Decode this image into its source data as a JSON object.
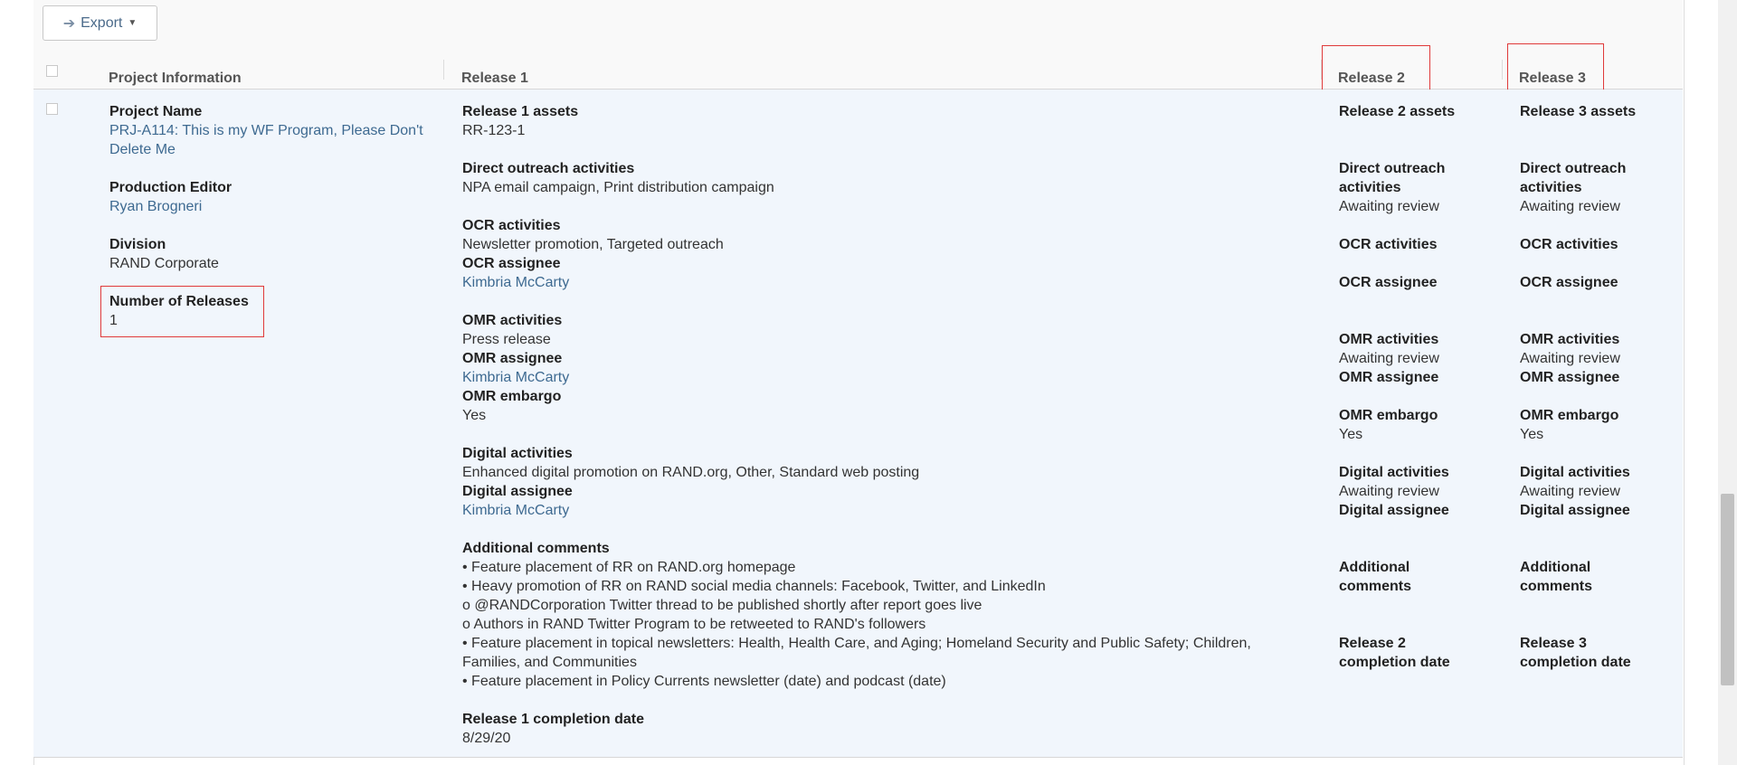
{
  "toolbar": {
    "export_label": "Export"
  },
  "headers": {
    "project_information": "Project Information",
    "release1": "Release 1",
    "release2": "Release 2",
    "release3": "Release 3"
  },
  "project": {
    "name_label": "Project Name",
    "name_line1": "PRJ-A114: This is my WF Program, Please Don't",
    "name_line2": "Delete Me",
    "editor_label": "Production Editor",
    "editor": "Ryan Brogneri",
    "division_label": "Division",
    "division": "RAND Corporate",
    "releases_label": "Number of Releases",
    "releases": "1"
  },
  "release1": {
    "assets_label": "Release 1 assets",
    "assets": "RR-123-1",
    "direct_label": "Direct outreach activities",
    "direct": "NPA email campaign, Print distribution campaign",
    "ocr_label": "OCR activities",
    "ocr": "Newsletter promotion, Targeted outreach",
    "ocr_assignee_label": "OCR assignee",
    "ocr_assignee": "Kimbria McCarty",
    "omr_label": "OMR activities",
    "omr": "Press release",
    "omr_assignee_label": "OMR assignee",
    "omr_assignee": "Kimbria McCarty",
    "omr_embargo_label": "OMR embargo",
    "omr_embargo": "Yes",
    "digital_label": "Digital activities",
    "digital": "Enhanced digital promotion on RAND.org, Other, Standard web posting",
    "digital_assignee_label": "Digital assignee",
    "digital_assignee": "Kimbria McCarty",
    "comments_label": "Additional comments",
    "comments": [
      "• Feature placement of RR on RAND.org homepage",
      "• Heavy promotion of RR on RAND social media channels: Facebook, Twitter, and LinkedIn",
      "o @RANDCorporation Twitter thread to be published shortly after report goes live",
      "o Authors in RAND Twitter Program to be retweeted to RAND's followers",
      "• Feature placement in topical newsletters: Health, Health Care, and Aging; Homeland Security and Public Safety; Children,",
      "Families, and Communities",
      "• Feature placement in Policy Currents newsletter (date) and podcast (date)"
    ],
    "completion_label": "Release 1 completion date",
    "completion": "8/29/20"
  },
  "release2": {
    "assets_label": "Release 2 assets",
    "direct_label_1": "Direct outreach",
    "direct_label_2": "activities",
    "direct": "Awaiting review",
    "ocr_label": "OCR activities",
    "ocr_assignee_label": "OCR assignee",
    "omr_label": "OMR activities",
    "omr": "Awaiting review",
    "omr_assignee_label": "OMR assignee",
    "omr_embargo_label": "OMR embargo",
    "omr_embargo": "Yes",
    "digital_label": "Digital activities",
    "digital": "Awaiting review",
    "digital_assignee_label": "Digital assignee",
    "comments_label_1": "Additional",
    "comments_label_2": "comments",
    "completion_label_1": "Release 2",
    "completion_label_2": "completion date"
  },
  "release3": {
    "assets_label": "Release 3 assets",
    "direct_label_1": "Direct outreach",
    "direct_label_2": "activities",
    "direct": "Awaiting review",
    "ocr_label": "OCR activities",
    "ocr_assignee_label": "OCR assignee",
    "omr_label": "OMR activities",
    "omr": "Awaiting review",
    "omr_assignee_label": "OMR assignee",
    "omr_embargo_label": "OMR embargo",
    "omr_embargo": "Yes",
    "digital_label": "Digital activities",
    "digital": "Awaiting review",
    "digital_assignee_label": "Digital assignee",
    "comments_label_1": "Additional",
    "comments_label_2": "comments",
    "completion_label_1": "Release 3",
    "completion_label_2": "completion date"
  },
  "colors": {
    "link": "#3e6a91",
    "row_background": "#f1f6fc",
    "highlight_box": "#e03a3a",
    "header_background": "#f9f9f9"
  },
  "icons": {
    "export": "arrow-right-icon",
    "dropdown": "caret-down-icon"
  }
}
